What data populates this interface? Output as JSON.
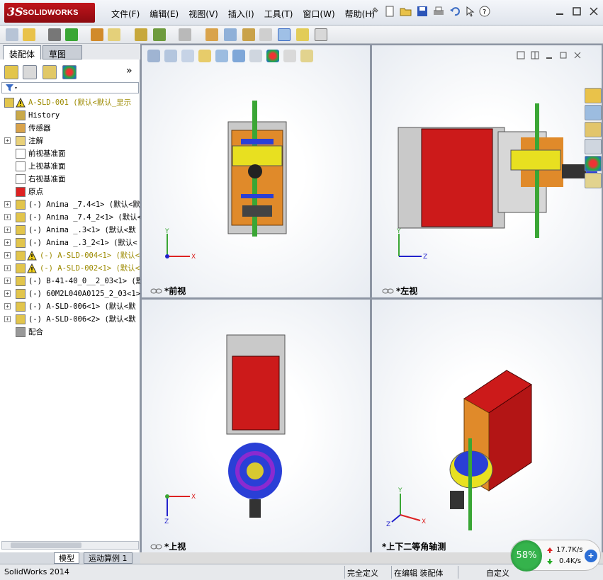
{
  "app": {
    "logo_mark": "3S",
    "logo_text": "SOLIDWORKS"
  },
  "menu": [
    "文件(F)",
    "编辑(E)",
    "视图(V)",
    "插入(I)",
    "工具(T)",
    "窗口(W)",
    "帮助(H)"
  ],
  "left_panel": {
    "tabs": [
      "装配体",
      "草图"
    ],
    "expand_glyph": "»",
    "tree": [
      {
        "label": "A-SLD-001  (默认<默认_显示",
        "warn": true,
        "icon": "assembly-icon"
      },
      {
        "label": "History",
        "icon": "history-icon"
      },
      {
        "label": "传感器",
        "icon": "sensor-icon"
      },
      {
        "label": "注解",
        "icon": "annotation-icon",
        "expand": true
      },
      {
        "label": "前视基准面",
        "icon": "plane-icon"
      },
      {
        "label": "上视基准面",
        "icon": "plane-icon"
      },
      {
        "label": "右视基准面",
        "icon": "plane-icon"
      },
      {
        "label": "原点",
        "icon": "origin-icon"
      },
      {
        "label": "(-) Anima _7.4<1> (默认<默",
        "icon": "part-icon",
        "expand": true
      },
      {
        "label": "(-) Anima _7.4_2<1> (默认<",
        "icon": "part-icon",
        "expand": true
      },
      {
        "label": "(-) Anima _.3<1> (默认<默",
        "icon": "part-icon",
        "expand": true
      },
      {
        "label": "(-) Anima _.3_2<1> (默认<",
        "icon": "part-icon",
        "expand": true
      },
      {
        "label": "(-) A-SLD-004<1> (默认<",
        "warn": true,
        "icon": "part-icon",
        "expand": true
      },
      {
        "label": "(-) A-SLD-002<1> (默认<",
        "warn": true,
        "icon": "part-icon",
        "expand": true
      },
      {
        "label": "(-) B-41-40_0__2_03<1> (默",
        "icon": "part-icon",
        "expand": true
      },
      {
        "label": "(-) 60M2L040A0125_2_03<1>",
        "icon": "part-icon",
        "expand": true
      },
      {
        "label": "(-) A-SLD-006<1> (默认<默",
        "icon": "part-icon",
        "expand": true
      },
      {
        "label": "(-) A-SLD-006<2> (默认<默",
        "icon": "part-icon",
        "expand": true
      },
      {
        "label": "配合",
        "icon": "mates-icon"
      }
    ],
    "bottom_tabs": [
      "模型",
      "运动算例 1"
    ]
  },
  "viewports": [
    {
      "label": "*前视",
      "axes": [
        "Y",
        "X"
      ]
    },
    {
      "label": "*左视",
      "axes": [
        "Y",
        "Z"
      ]
    },
    {
      "label": "*上视",
      "axes": [
        "Z",
        "X"
      ]
    },
    {
      "label": "*上下二等角轴测",
      "axes": [
        "Y",
        "X",
        "Z"
      ]
    }
  ],
  "status_bar": {
    "app_version": "SolidWorks 2014",
    "status1": "完全定义",
    "status2": "在编辑 装配体",
    "status3": "自定义"
  },
  "net_widget": {
    "percent": "58%",
    "up": "17.7K/s",
    "down": "0.4K/s",
    "plus": "+"
  },
  "colors": {
    "accent_red": "#cc1a1a",
    "frame_green": "#3aa635",
    "motor_blue": "#2a3fd6",
    "background": "#dcdcdc"
  }
}
